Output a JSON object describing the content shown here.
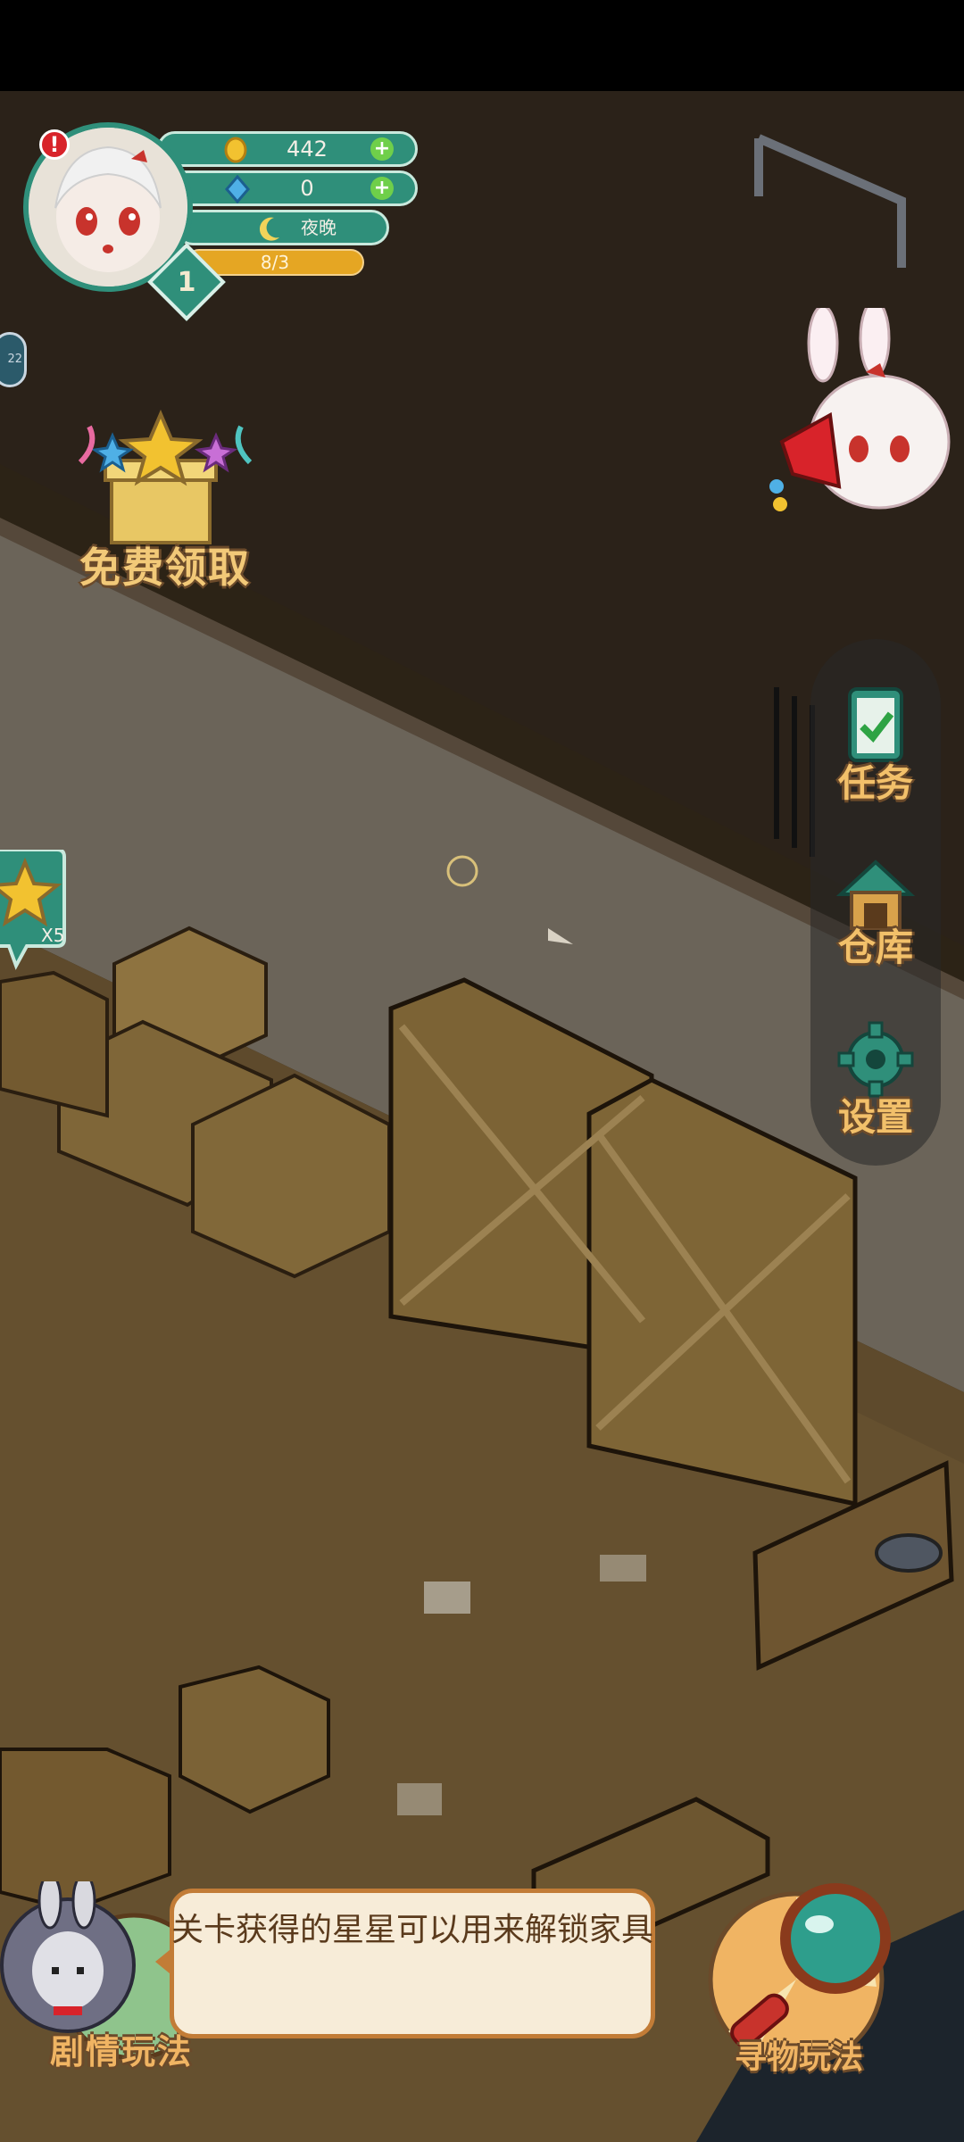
{
  "hud": {
    "coins": "442",
    "gems": "0",
    "time_of_day": "夜晚",
    "energy": "8/3",
    "level": "1",
    "alert": "!"
  },
  "side_badge": "22",
  "free_gift": {
    "label": "免费领取"
  },
  "menu": {
    "items": [
      {
        "label": "任务",
        "icon": "clipboard-check-icon"
      },
      {
        "label": "仓库",
        "icon": "warehouse-icon"
      },
      {
        "label": "设置",
        "icon": "gear-icon"
      }
    ]
  },
  "star_reward": {
    "multiplier": "X5"
  },
  "bottom": {
    "story_label": "剧情玩法",
    "find_label": "寻物玩法"
  },
  "tutorial": {
    "text": "关卡获得的星星可以用来解锁家具"
  },
  "colors": {
    "teal": "#2f8f7a",
    "label_gold": "#f2c06a",
    "bubble_bg": "#f7ecd8",
    "bubble_border": "#c27c37"
  }
}
